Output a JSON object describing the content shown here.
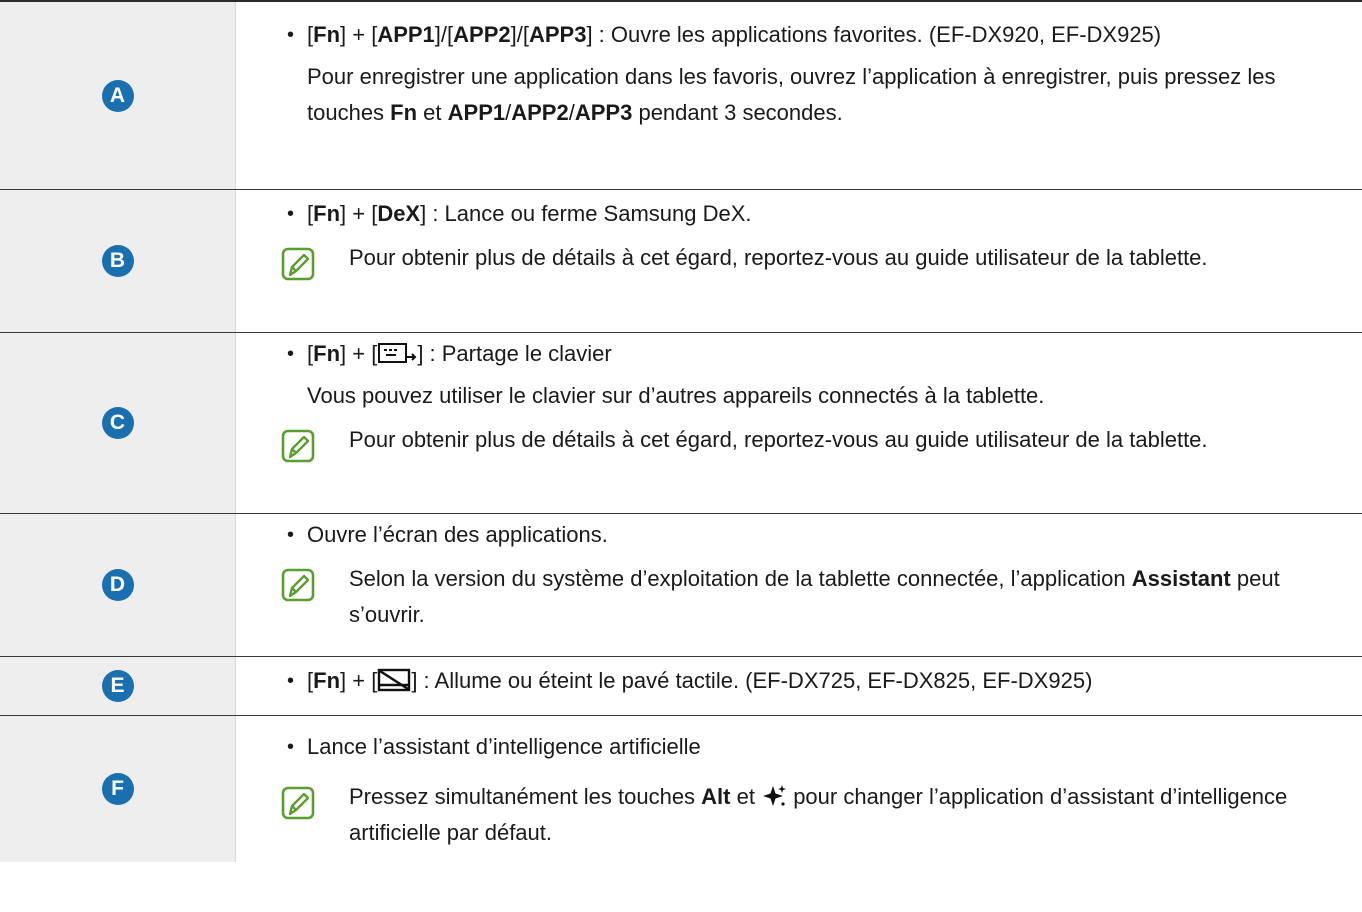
{
  "colors": {
    "badge": "#1a6fae",
    "label_bg": "#eeeeee",
    "note_icon": "#5a9e2f"
  },
  "rows": [
    {
      "label": "A",
      "line1": {
        "o1": "[",
        "k1": "Fn",
        "o2": "] + [",
        "k2": "APP1",
        "o3": "]/[",
        "k3": "APP2",
        "o4": "]/[",
        "k4": "APP3",
        "o5": "] : Ouvre les applications favorites. (EF-DX920, EF-DX925)"
      },
      "para": {
        "t1": "Pour enregistrer une application dans les favoris, ouvrez l’application à enregistrer, puis pressez les touches ",
        "k1": "Fn",
        "t2": " et ",
        "k2": "APP1",
        "t3": "/",
        "k3": "APP2",
        "t4": "/",
        "k4": "APP3",
        "t5": " pendant 3 secondes."
      }
    },
    {
      "label": "B",
      "line1": {
        "o1": "[",
        "k1": "Fn",
        "o2": "] + [",
        "k2": "DeX",
        "o3": "] : Lance ou ferme Samsung DeX."
      },
      "note": "Pour obtenir plus de détails à cet égard, reportez-vous au guide utilisateur de la tablette."
    },
    {
      "label": "C",
      "line1": {
        "o1": "[",
        "k1": "Fn",
        "o2": "] + [",
        "o3": "] : Partage le clavier"
      },
      "icon": "keyboard-share-icon",
      "para": "Vous pouvez utiliser le clavier sur d’autres appareils connectés à la tablette.",
      "note": "Pour obtenir plus de détails à cet égard, reportez-vous au guide utilisateur de la tablette."
    },
    {
      "label": "D",
      "line1": "Ouvre l’écran des applications.",
      "note": {
        "t1": "Selon la version du système d’exploitation de la tablette connectée, l’application ",
        "k1": "Assistant",
        "t2": " peut s’ouvrir."
      }
    },
    {
      "label": "E",
      "line1": {
        "o1": "[",
        "k1": "Fn",
        "o2": "] + [",
        "o3": "] : Allume ou éteint le pavé tactile. (EF-DX725, EF-DX825, EF-DX925)"
      },
      "icon": "touchpad-off-icon"
    },
    {
      "label": "F",
      "line1": "Lance l’assistant d’intelligence artificielle",
      "icon": "sparkle-icon",
      "note": {
        "t1": "Pressez simultanément les touches ",
        "k1": "Alt",
        "t2": " et ",
        "t3": " pour changer l’application d’assistant d’intelligence artificielle par défaut."
      }
    }
  ]
}
